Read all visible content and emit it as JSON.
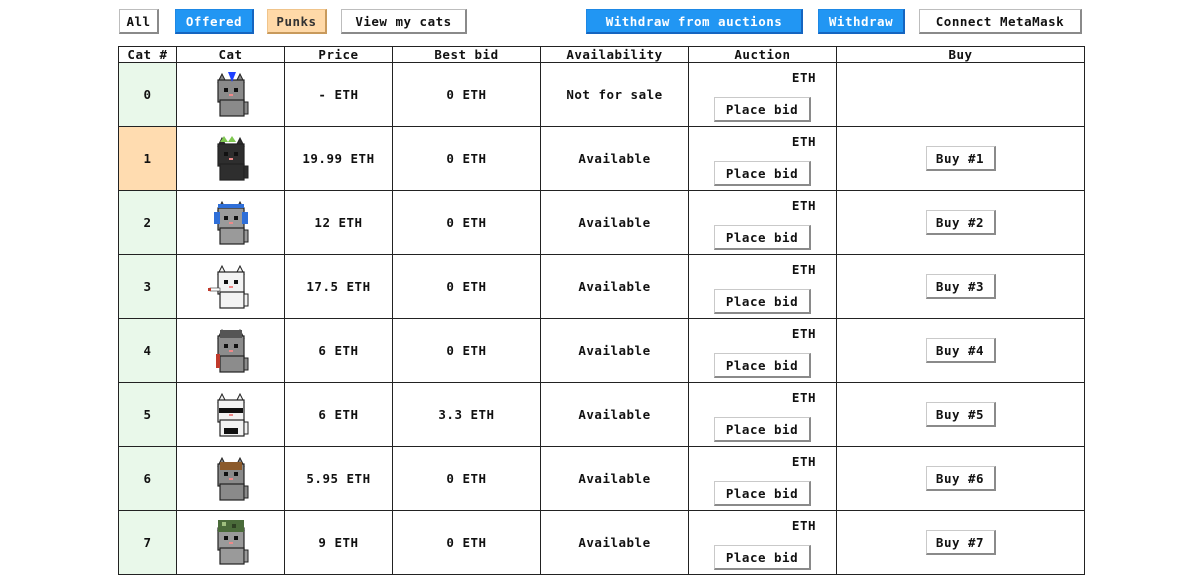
{
  "toolbar": {
    "all": "All",
    "offered": "Offered",
    "punks": "Punks",
    "view_my_cats": "View my cats",
    "withdraw_auctions": "Withdraw from auctions",
    "withdraw": "Withdraw",
    "connect": "Connect MetaMask"
  },
  "colors": {
    "accent_blue": "#2196f3",
    "punk_peach": "#ffd9a8",
    "available_green": "#e9f8ea",
    "offered_orange": "#ffdcb0"
  },
  "table": {
    "headers": [
      "Cat #",
      "Cat",
      "Price",
      "Best bid",
      "Availability",
      "Auction",
      "Buy"
    ],
    "rows": [
      {
        "num": "0",
        "cat_icon": "gray-cat-blue-mohawk-icon",
        "price": "- ETH",
        "best_bid": "0 ETH",
        "availability": "Not for sale",
        "auction_eth": "ETH",
        "place_bid": "Place bid",
        "buy": ""
      },
      {
        "num": "1",
        "cat_icon": "black-cat-crown-icon",
        "price": "19.99 ETH",
        "best_bid": "0 ETH",
        "availability": "Available",
        "auction_eth": "ETH",
        "place_bid": "Place bid",
        "buy": "Buy #1"
      },
      {
        "num": "2",
        "cat_icon": "gray-cat-headphones-icon",
        "price": "12 ETH",
        "best_bid": "0 ETH",
        "availability": "Available",
        "auction_eth": "ETH",
        "place_bid": "Place bid",
        "buy": "Buy #2"
      },
      {
        "num": "3",
        "cat_icon": "white-cat-cigarette-icon",
        "price": "17.5 ETH",
        "best_bid": "0 ETH",
        "availability": "Available",
        "auction_eth": "ETH",
        "place_bid": "Place bid",
        "buy": "Buy #3"
      },
      {
        "num": "4",
        "cat_icon": "gray-cat-skull-cap-icon",
        "price": "6 ETH",
        "best_bid": "0 ETH",
        "availability": "Available",
        "auction_eth": "ETH",
        "place_bid": "Place bid",
        "buy": "Buy #4"
      },
      {
        "num": "5",
        "cat_icon": "white-cat-sunglasses-icon",
        "price": "6 ETH",
        "best_bid": "3.3 ETH",
        "availability": "Available",
        "auction_eth": "ETH",
        "place_bid": "Place bid",
        "buy": "Buy #5"
      },
      {
        "num": "6",
        "cat_icon": "gray-cat-brown-hat-icon",
        "price": "5.95 ETH",
        "best_bid": "0 ETH",
        "availability": "Available",
        "auction_eth": "ETH",
        "place_bid": "Place bid",
        "buy": "Buy #6"
      },
      {
        "num": "7",
        "cat_icon": "gray-cat-camo-hat-icon",
        "price": "9 ETH",
        "best_bid": "0 ETH",
        "availability": "Available",
        "auction_eth": "ETH",
        "place_bid": "Place bid",
        "buy": "Buy #7"
      }
    ]
  }
}
